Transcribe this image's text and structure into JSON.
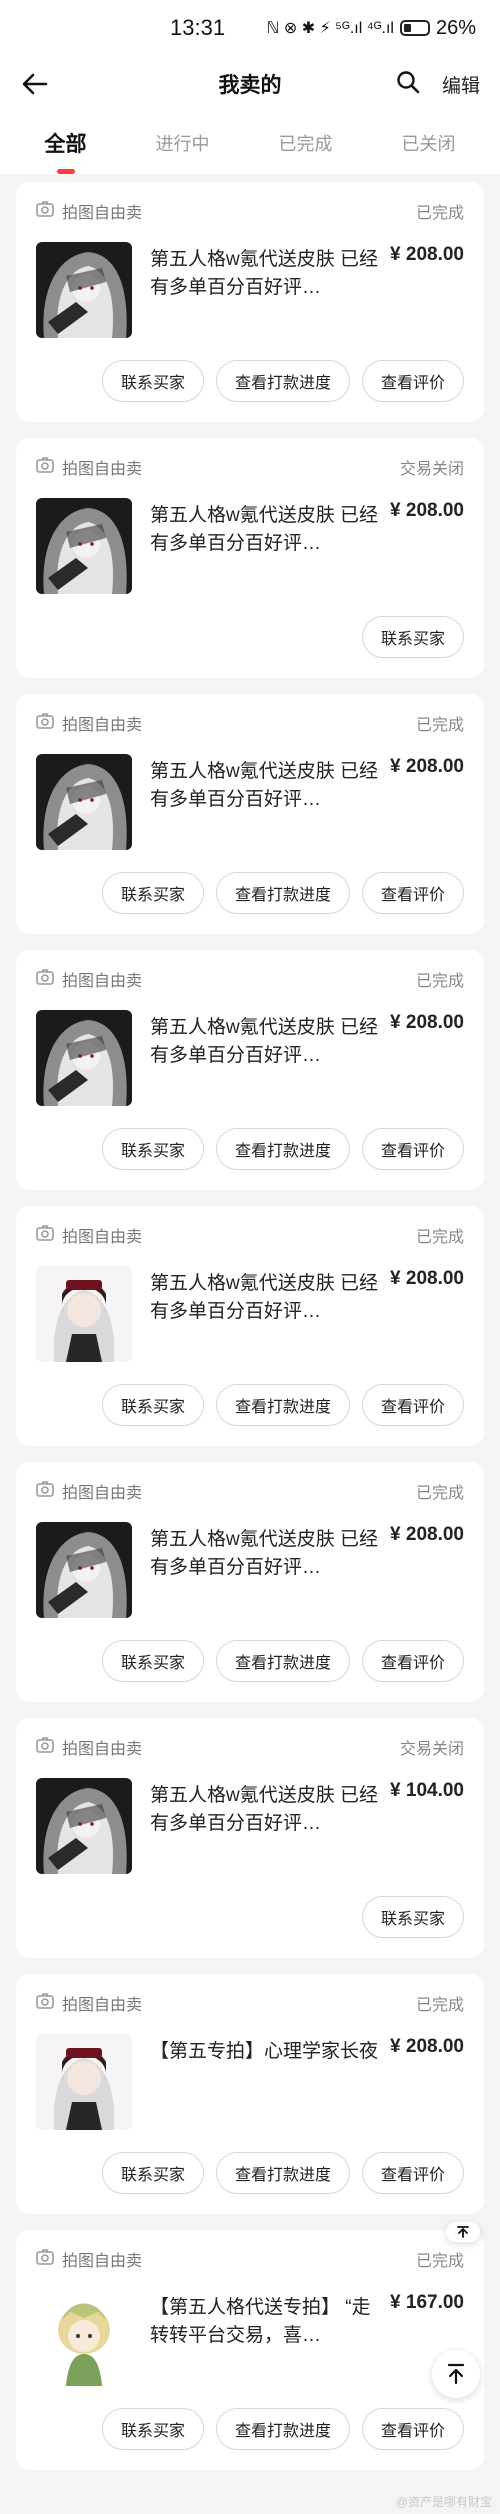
{
  "statusbar": {
    "time": "13:31",
    "indicators": "ℕ ⊗ ✱ ⚡ ⁵ᴳ.ıl ⁴ᴳ.ıl",
    "battery": "26%"
  },
  "header": {
    "title": "我卖的",
    "edit_label": "编辑"
  },
  "tabs": [
    {
      "label": "全部",
      "active": true
    },
    {
      "label": "进行中",
      "active": false
    },
    {
      "label": "已完成",
      "active": false
    },
    {
      "label": "已关闭",
      "active": false
    }
  ],
  "orders": [
    {
      "source": "拍图自由卖",
      "status": "已完成",
      "title": "第五人格w氪代送皮肤 已经有多单百分百好评…",
      "price": "¥ 208.00",
      "thumb": "dark",
      "buttons": [
        "联系买家",
        "查看打款进度",
        "查看评价"
      ]
    },
    {
      "source": "拍图自由卖",
      "status": "交易关闭",
      "title": "第五人格w氪代送皮肤 已经有多单百分百好评…",
      "price": "¥ 208.00",
      "thumb": "dark",
      "buttons": [
        "联系买家"
      ]
    },
    {
      "source": "拍图自由卖",
      "status": "已完成",
      "title": "第五人格w氪代送皮肤 已经有多单百分百好评…",
      "price": "¥ 208.00",
      "thumb": "dark",
      "buttons": [
        "联系买家",
        "查看打款进度",
        "查看评价"
      ]
    },
    {
      "source": "拍图自由卖",
      "status": "已完成",
      "title": "第五人格w氪代送皮肤 已经有多单百分百好评…",
      "price": "¥ 208.00",
      "thumb": "dark",
      "buttons": [
        "联系买家",
        "查看打款进度",
        "查看评价"
      ]
    },
    {
      "source": "拍图自由卖",
      "status": "已完成",
      "title": "第五人格w氪代送皮肤 已经有多单百分百好评…",
      "price": "¥ 208.00",
      "thumb": "light",
      "buttons": [
        "联系买家",
        "查看打款进度",
        "查看评价"
      ]
    },
    {
      "source": "拍图自由卖",
      "status": "已完成",
      "title": "第五人格w氪代送皮肤 已经有多单百分百好评…",
      "price": "¥ 208.00",
      "thumb": "dark",
      "buttons": [
        "联系买家",
        "查看打款进度",
        "查看评价"
      ]
    },
    {
      "source": "拍图自由卖",
      "status": "交易关闭",
      "title": "第五人格w氪代送皮肤 已经有多单百分百好评…",
      "price": "¥ 104.00",
      "thumb": "dark",
      "buttons": [
        "联系买家"
      ]
    },
    {
      "source": "拍图自由卖",
      "status": "已完成",
      "title": "【第五专拍】心理学家长夜",
      "price": "¥ 208.00",
      "thumb": "light",
      "buttons": [
        "联系买家",
        "查看打款进度",
        "查看评价"
      ]
    },
    {
      "source": "拍图自由卖",
      "status": "已完成",
      "title": "【第五人格代送专拍】 “走转转平台交易，喜…",
      "price": "¥ 167.00",
      "thumb": "green",
      "buttons": [
        "联系买家",
        "查看打款进度",
        "查看评价"
      ]
    }
  ],
  "watermark": "@资产是哪有财宝",
  "colors": {
    "accent": "#ff3b3b",
    "background": "#f4f4f4"
  }
}
